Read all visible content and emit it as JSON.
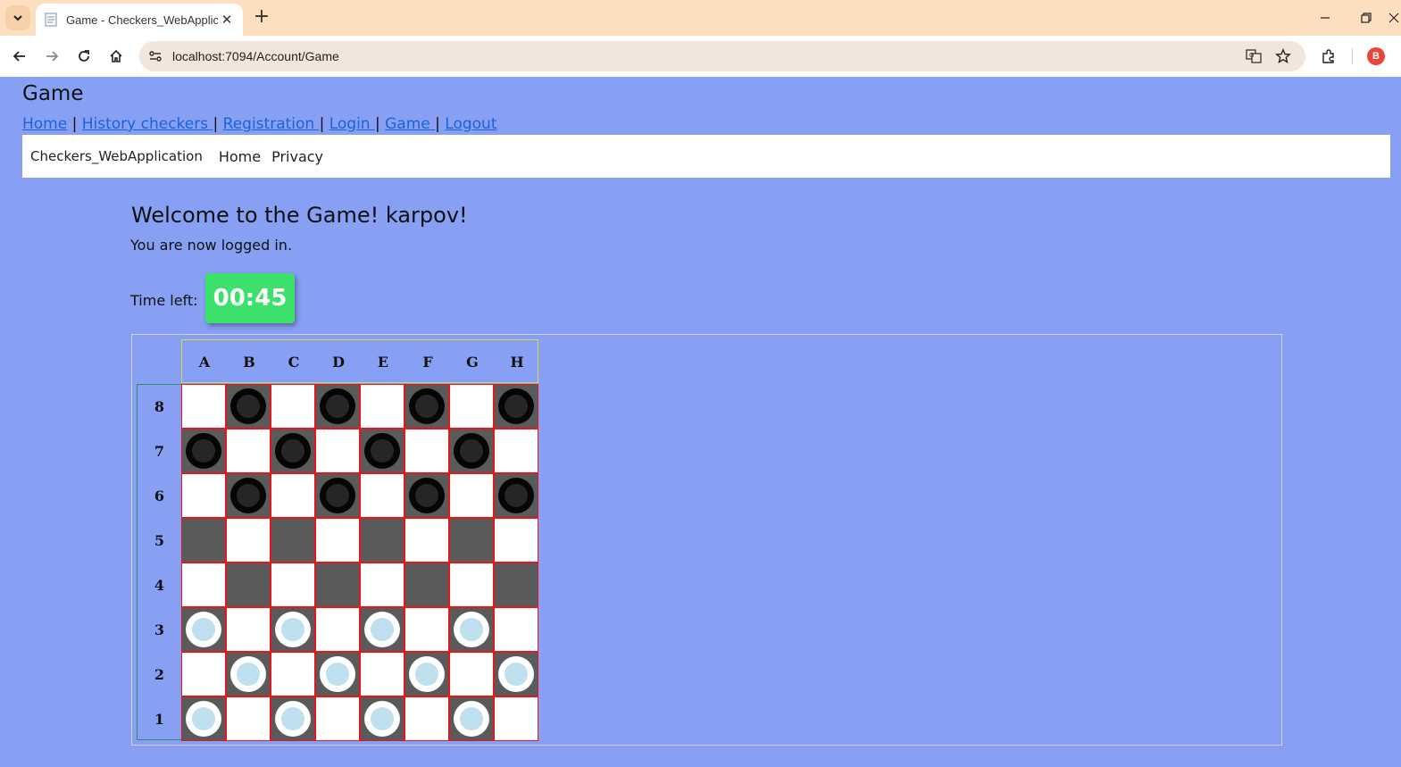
{
  "browser": {
    "tab_title": "Game - Checkers_WebApplication",
    "url": "localhost:7094/Account/Game",
    "profile_initial": "B"
  },
  "page": {
    "heading": "Game",
    "links": [
      "Home",
      "History checkers ",
      "Registration ",
      "Login ",
      "Game ",
      "Logout"
    ],
    "link_separator": "|"
  },
  "app_nav": {
    "brand": "Checkers_WebApplication",
    "items": [
      "Home",
      "Privacy"
    ]
  },
  "game": {
    "welcome": "Welcome to the Game! karpov!",
    "status": "You are now logged in.",
    "timer_label": "Time left:",
    "timer_value": "00:45",
    "timer_color": "#3be16b",
    "columns": [
      "A",
      "B",
      "C",
      "D",
      "E",
      "F",
      "G",
      "H"
    ],
    "rows": [
      "8",
      "7",
      "6",
      "5",
      "4",
      "3",
      "2",
      "1"
    ],
    "board": [
      [
        "",
        "b",
        "",
        "b",
        "",
        "b",
        "",
        "b"
      ],
      [
        "b",
        "",
        "b",
        "",
        "b",
        "",
        "b",
        ""
      ],
      [
        "",
        "b",
        "",
        "b",
        "",
        "b",
        "",
        "b"
      ],
      [
        "",
        "",
        "",
        "",
        "",
        "",
        "",
        ""
      ],
      [
        "",
        "",
        "",
        "",
        "",
        "",
        "",
        ""
      ],
      [
        "w",
        "",
        "w",
        "",
        "w",
        "",
        "w",
        ""
      ],
      [
        "",
        "w",
        "",
        "w",
        "",
        "w",
        "",
        "w"
      ],
      [
        "w",
        "",
        "w",
        "",
        "w",
        "",
        "w",
        ""
      ]
    ]
  }
}
